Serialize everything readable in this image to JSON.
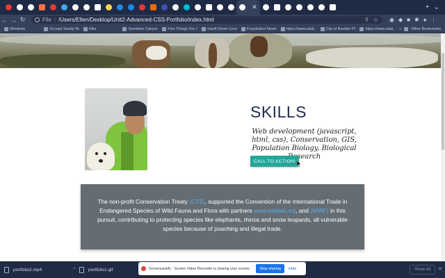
{
  "browser": {
    "tab_favicon_colors": [
      "#e53935",
      "#ffffff",
      "#ffffff",
      "#ff7043",
      "#e53935",
      "#42a5f5",
      "#ffffff",
      "#ffffff",
      "#ffffff",
      "#ffd54f",
      "#1e88e5",
      "#1e88e5",
      "#e53935",
      "#ef6c00",
      "#3f51b5",
      "#ffffff",
      "#00bcd4",
      "#ffffff",
      "#ffffff",
      "#ffffff",
      "#ffffff",
      "#ffffff",
      "#ffffff",
      "#ffffff",
      "#ffffff",
      "#ffffff",
      "#ffffff",
      "#ffffff",
      "#ffffff"
    ],
    "new_tab_label": "+",
    "address": {
      "scheme": "File",
      "url": "/Users/Ellen/Desktop/Unit2-Advanced-CSS-Portfolio/index.html"
    },
    "bookmarks": [
      "Windows",
      "Occupy Sandy Re...",
      "Hike",
      "Sunshine Canyon...",
      "Five Things You S...",
      "Insoft Driver Licen...",
      "Foundation News",
      "https://www.stati...",
      "City of Boulder Pl...",
      "https://www.stati..."
    ],
    "bookmarks_more": "»",
    "other_bookmarks": "Other Bookmarks"
  },
  "page": {
    "skills_title": "SKILLS",
    "skills_description": "Web development (javascript, html, css), Conservation, GIS, Population Biology, Biological Research",
    "cta_label": "CALL TO ACTION!",
    "info": {
      "p1": "The non-profit Conservation Treaty ",
      "link1": "(CTS)",
      "p2": ", supported the Convention of the International Trade in Endangered Species of Wild Fauna and Flora with partners ",
      "link2": "www.wildaid.org",
      "p3": ", and ",
      "link3": "(WWF)",
      "p4": " in this pursuit, contributing to protecting species like elephants, rhinos and snow leopards, all vulnerable species because of poaching and illegal trade."
    }
  },
  "downloads": [
    {
      "name": "portfolio2.mp4"
    },
    {
      "name": "portfolio1.gif"
    }
  ],
  "show_all_label": "Show All",
  "notification": {
    "text": "Screencastify - Screen Video Recorder is sharing your screen.",
    "stop_label": "Stop sharing",
    "hide_label": "Hide"
  }
}
